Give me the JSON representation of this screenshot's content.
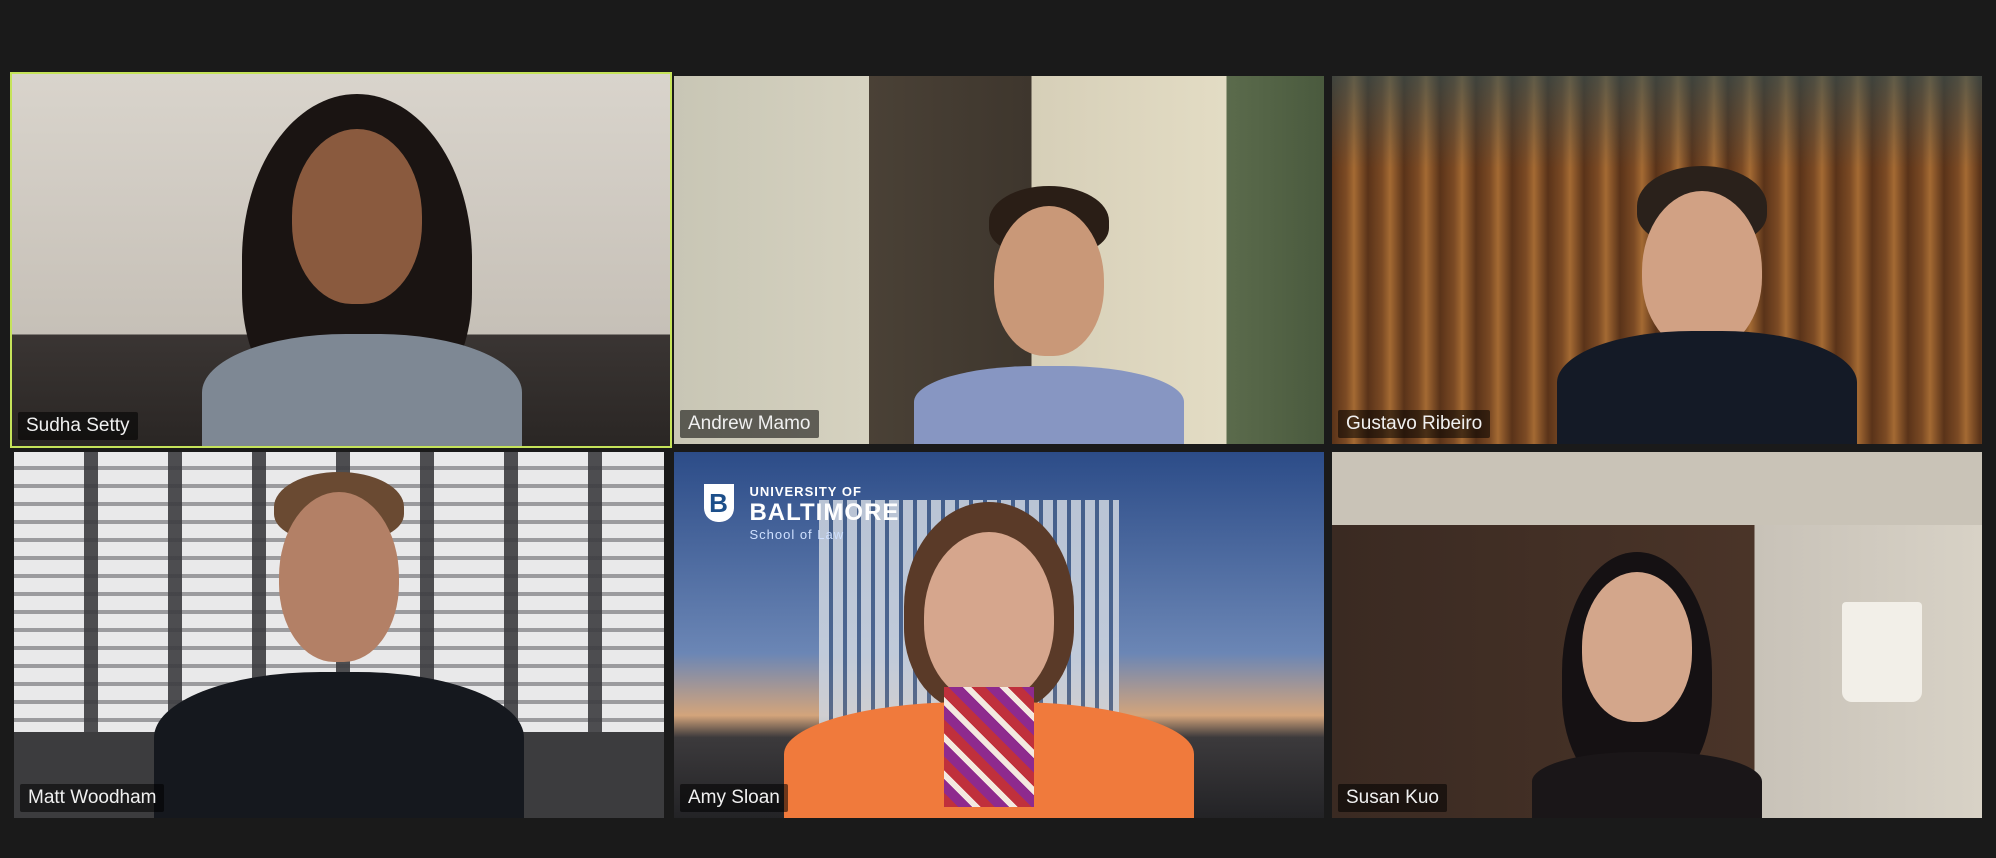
{
  "meeting": {
    "participants": [
      {
        "name": "Sudha Setty",
        "active_speaker": true
      },
      {
        "name": "Andrew Mamo",
        "active_speaker": false
      },
      {
        "name": "Gustavo Ribeiro",
        "active_speaker": false
      },
      {
        "name": "Matt Woodham",
        "active_speaker": false
      },
      {
        "name": "Amy Sloan",
        "active_speaker": false
      },
      {
        "name": "Susan Kuo",
        "active_speaker": false
      }
    ],
    "virtual_background_logo": {
      "line1": "UNIVERSITY OF",
      "line2": "BALTIMORE",
      "line3": "School of Law",
      "badge_letter": "B"
    },
    "active_speaker_color": "#c5e35a"
  }
}
